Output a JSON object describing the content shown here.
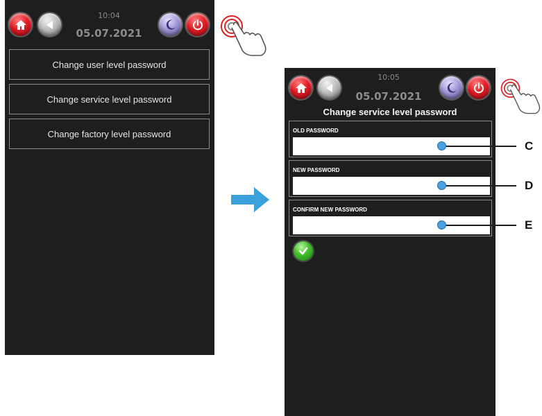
{
  "screen1": {
    "time": "10:04",
    "date": "05.07.2021",
    "menu": [
      {
        "label": "Change user level password"
      },
      {
        "label": "Change service level password"
      },
      {
        "label": "Change factory level password"
      }
    ]
  },
  "screen2": {
    "time": "10:05",
    "date": "05.07.2021",
    "title": "Change service level password",
    "fields": [
      {
        "label": "OLD PASSWORD",
        "value": "",
        "callout": "C"
      },
      {
        "label": "NEW PASSWORD",
        "value": "",
        "callout": "D"
      },
      {
        "label": "CONFIRM NEW PASSWORD",
        "value": "",
        "callout": "E"
      }
    ]
  },
  "colors": {
    "screen_bg": "#1e1e1e",
    "accent_arrow": "#3ba0dc",
    "callout_dot": "#4aa3df",
    "home_red": "#e01b24",
    "confirm_green": "#3fbf2a"
  },
  "icons": [
    "home-icon",
    "back-icon",
    "night-mode-icon",
    "power-icon",
    "touch-hand-icon",
    "arrow-right-icon",
    "check-icon"
  ]
}
